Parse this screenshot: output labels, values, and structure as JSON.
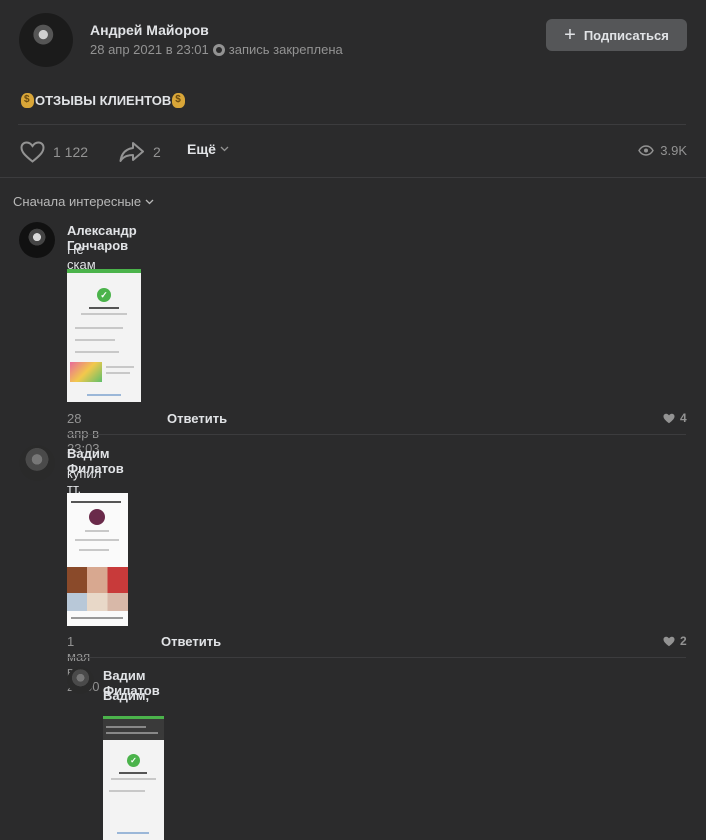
{
  "post": {
    "author": "Андрей Майоров",
    "date": "28 апр 2021 в 23:01",
    "pinned": "запись закреплена",
    "subscribe_label": "Подписаться",
    "text": "ОТЗЫВЫ КЛИЕНТОВ",
    "likes": "1 122",
    "shares": "2",
    "more_label": "Ещё",
    "views": "3.9K"
  },
  "comments_sort": "Сначала интересные",
  "comments": [
    {
      "author": "Александр Гончаров",
      "text": "Не скам",
      "date": "28 апр в 23:03",
      "reply_label": "Ответить",
      "likes": "4"
    },
    {
      "author": "Вадим Филатов",
      "text": "купил тт, топ",
      "date": "1 мая в 21:00",
      "reply_label": "Ответить",
      "likes": "2"
    },
    {
      "author": "Вадим Филатов",
      "text": "Вадим,"
    }
  ],
  "colors": {
    "background": "#2b2b2c",
    "button": "#555658",
    "accent_green": "#4bb34b"
  }
}
